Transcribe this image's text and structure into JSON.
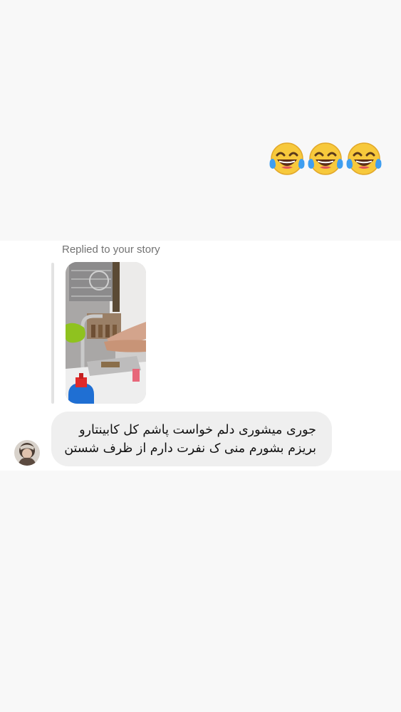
{
  "sent_message": {
    "emoji_text": "😂😂😂",
    "emoji_count": 3,
    "emoji_icon": "face-with-tears-of-joy-icon"
  },
  "story_reply": {
    "label": "Replied to your story",
    "thumbnail_icon": "story-thumbnail-icon"
  },
  "received_message": {
    "line_1": "جوری میشوری دلم خواست پاشم کل کابینتارو",
    "line_2": "بریزم بشورم منی ک نفرت دارم از ظرف شستن",
    "avatar_icon": "avatar-icon"
  },
  "colors": {
    "background": "#f8f8f8",
    "chat_background": "#ffffff",
    "bubble": "#efefef",
    "label": "#737373",
    "text": "#111111",
    "reply_bar": "#e3e3e3"
  }
}
